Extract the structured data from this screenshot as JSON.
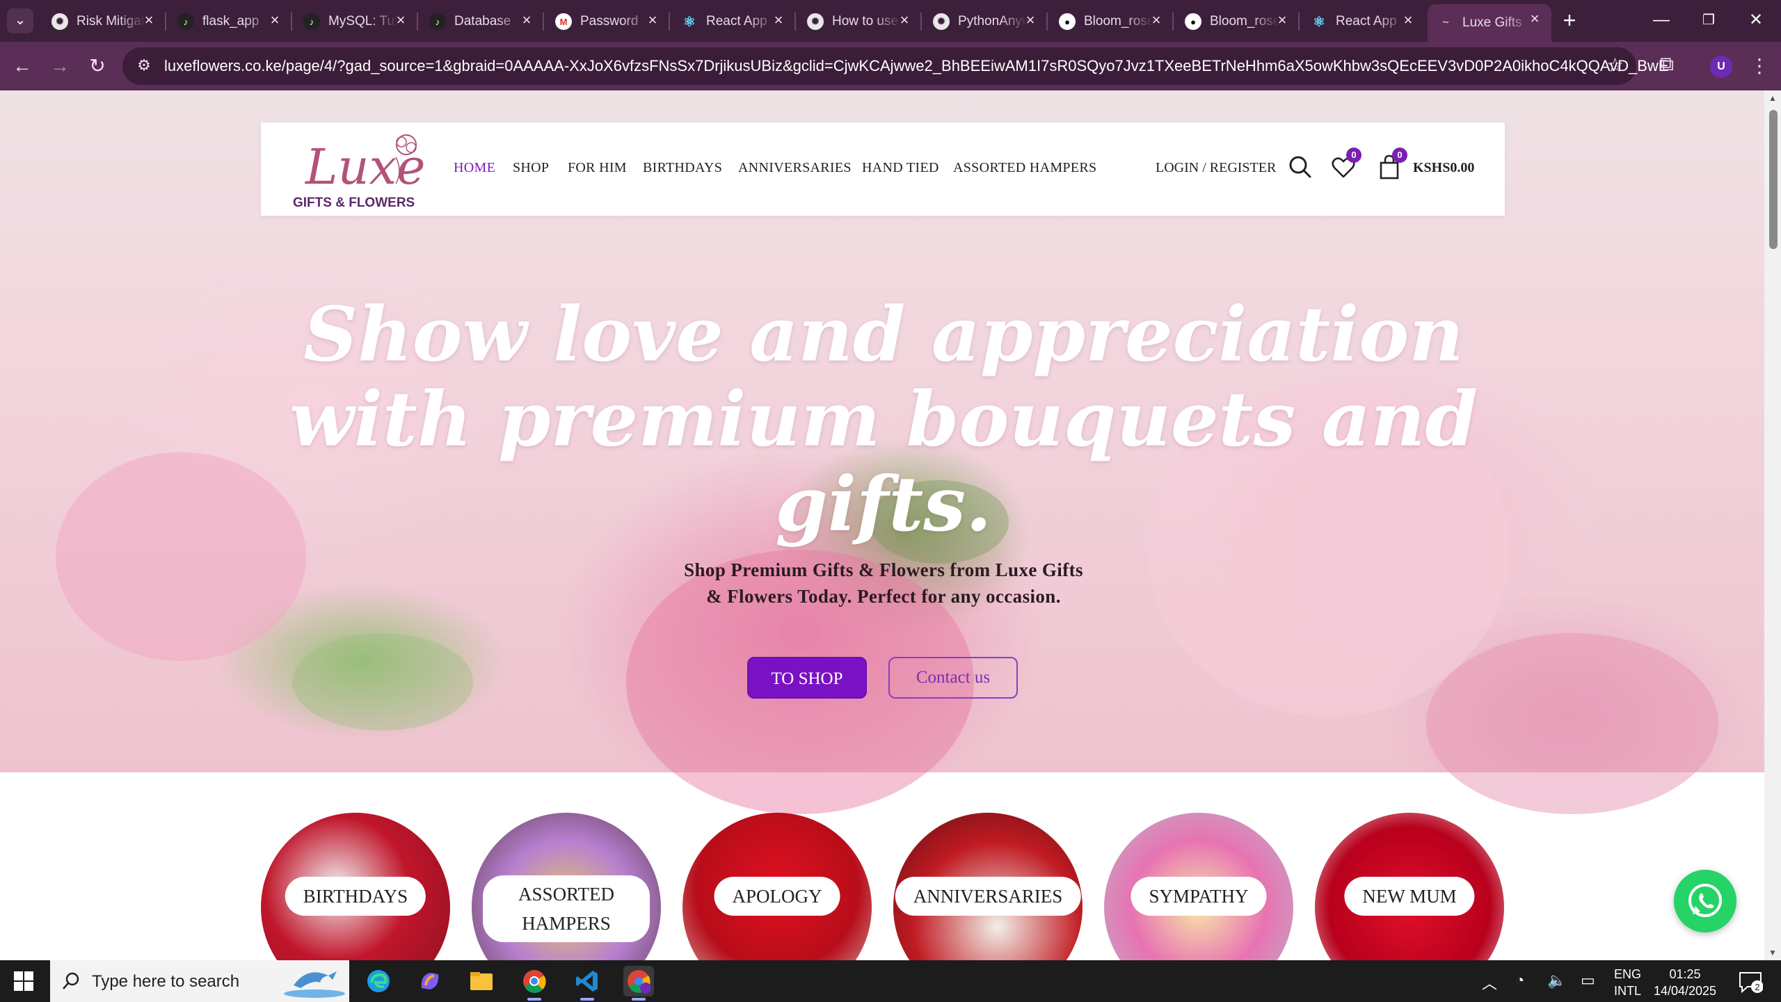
{
  "browser": {
    "tabs": [
      {
        "label": "Risk Mitigation",
        "icon": "openai-icon"
      },
      {
        "label": "flask_app",
        "icon": "tiktok-icon"
      },
      {
        "label": "MySQL: Tutorial",
        "icon": "tiktok-icon"
      },
      {
        "label": "Database",
        "icon": "tiktok-icon"
      },
      {
        "label": "Password",
        "icon": "gmail-icon"
      },
      {
        "label": "React App",
        "icon": "react-icon"
      },
      {
        "label": "How to use",
        "icon": "openai-icon"
      },
      {
        "label": "PythonAnywhere",
        "icon": "openai-icon"
      },
      {
        "label": "Bloom_rose",
        "icon": "github-icon"
      },
      {
        "label": "Bloom_rose",
        "icon": "github-icon"
      },
      {
        "label": "React App",
        "icon": "react-icon"
      },
      {
        "label": "Luxe Gifts",
        "icon": "luxe-icon"
      }
    ],
    "url": "luxeflowers.co.ke/page/4/?gad_source=1&gbraid=0AAAAA-XxJoX6vfzsFNsSx7DrjikusUBiz&gclid=CjwKCAjwwe2_BhBEEiwAM1I7sR0SQyo7Jvz1TXeeBETrNeHhm6aX5owKhbw3sQEcEEV3vD0P2A0ikhoC4kQQAvD_BwE",
    "profile_initial": "U"
  },
  "site": {
    "logo_script": "Luxe",
    "logo_sub": "GIFTS & FLOWERS",
    "nav": [
      "HOME",
      "SHOP",
      "FOR HIM",
      "BIRTHDAYS",
      "ANNIVERSARIES",
      "HAND TIED",
      "ASSORTED HAMPERS"
    ],
    "login": "LOGIN / REGISTER",
    "wishlist_count": "0",
    "cart_count": "0",
    "cart_total": "KSHS0.00"
  },
  "hero": {
    "title": "Show love and appreciation with premium bouquets and gifts.",
    "subtitle": "Shop Premium Gifts & Flowers from Luxe Gifts & Flowers Today. Perfect for any occasion.",
    "primary_button": "TO SHOP",
    "secondary_button": "Contact us"
  },
  "categories": [
    {
      "label": "BIRTHDAYS"
    },
    {
      "label": "ASSORTED HAMPERS"
    },
    {
      "label": "APOLOGY"
    },
    {
      "label": "ANNIVERSARIES"
    },
    {
      "label": "SYMPATHY"
    },
    {
      "label": "NEW MUM"
    }
  ],
  "taskbar": {
    "search_placeholder": "Type here to search",
    "lang_top": "ENG",
    "lang_bottom": "INTL",
    "time": "01:25",
    "date": "14/04/2025",
    "notification_count": "2"
  },
  "colors": {
    "accent": "#7a12c4",
    "chrome_bg": "#3c1f3a",
    "whatsapp": "#25d366"
  }
}
